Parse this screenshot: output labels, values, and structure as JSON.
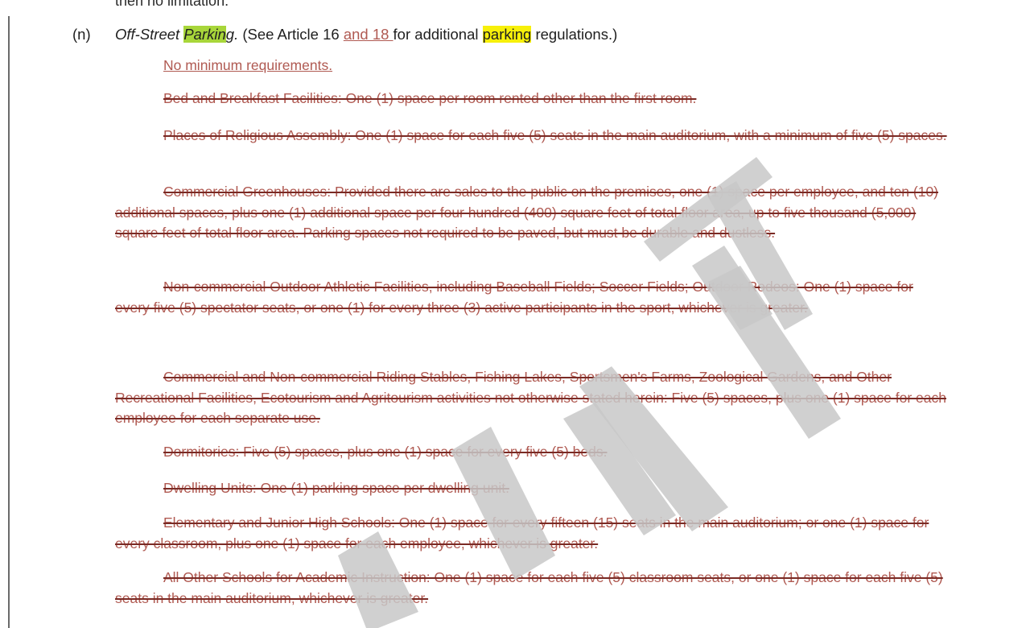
{
  "top_cut_text": "then no limitation.",
  "section": {
    "number": "(n)",
    "title_prefix": "Off-Street ",
    "title_highlight": "Parkin",
    "title_suffix": "g.",
    "see_text": " (See Article 16 ",
    "inserted_ref": "and 18 ",
    "for_text": "for additional ",
    "parking_word": "parking",
    "end_text": " regulations.)"
  },
  "inserted_paragraph": "No minimum requirements.",
  "deleted_paragraphs": [
    "Bed and Breakfast Facilities: One (1) space per room rented other than the first room.",
    "Places of Religious Assembly: One (1) space for each five (5) seats in the main auditorium, with a minimum of five (5) spaces.",
    "Commercial Greenhouses: Provided there are sales to the public on the premises, one (1) space per employee, and ten (10) additional spaces, plus one (1) additional space per four hundred (400) square feet of total floor area, up to five thousand (5,000) square feet of total floor area. Parking spaces not required to be paved, but must be durable and dustless.",
    "Non-commercial Outdoor Athletic Facilities, including Baseball Fields; Soccer Fields; Outdoor Rodeos: One (1) space for every five (5) spectator seats, or one (1) for every three (3) active participants in the sport, whichever is greater.",
    "Commercial and Non-commercial Riding Stables, Fishing Lakes, Sportsmen's Farms, Zoological Gardens, and Other Recreational Facilities, Ecotourism and Agritourism activities not otherwise stated herein: Five (5) spaces, plus one (1) space for each employee for each separate use.",
    "Dormitories: Five (5) spaces, plus one (1) space for every five (5) beds.",
    "Dwelling Units: One (1) parking space per dwelling unit.",
    "Elementary and Junior High Schools: One (1) space for every fifteen (15) seats in the main auditorium; or one (1) space for every classroom, plus one (1) space for each employee, whichever is greater.",
    "All Other Schools for Academic Instruction: One (1) space for each five (5) classroom seats, or one (1) space for each five (5) seats in the main auditorium, whichever is greater."
  ],
  "colors": {
    "deleted_text": "#b05a52",
    "strike_line": "#7a2a24",
    "highlight_green": "#a8d63a",
    "highlight_yellow": "#f7f00a",
    "watermark": "#c8c8c8"
  }
}
